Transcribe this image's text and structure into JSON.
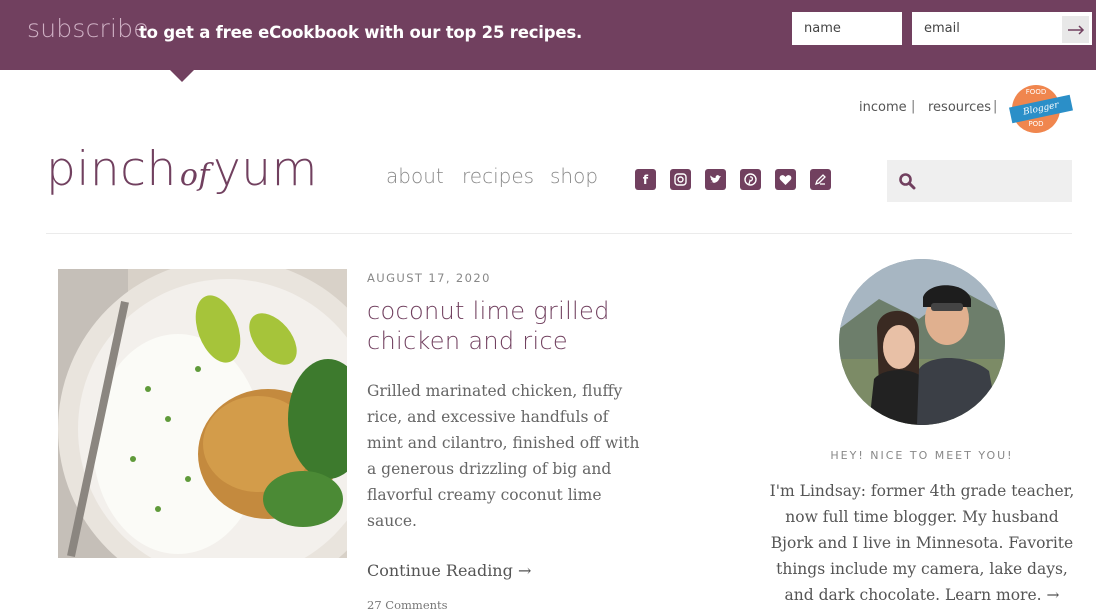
{
  "subscribe_bar": {
    "headline": "subscribe",
    "tagline": "to get a free eCookbook with our top 25 recipes.",
    "name_placeholder": "name",
    "email_placeholder": "email",
    "submit_icon": "arrow-right-icon"
  },
  "utility_nav": {
    "items": [
      "income",
      "resources"
    ],
    "separator": "|",
    "badge": {
      "top": "FOOD",
      "ribbon": "Blogger",
      "bottom": "POD"
    }
  },
  "logo": {
    "part1": "pinch",
    "part2": "of",
    "part3": "yum"
  },
  "main_nav": {
    "items": [
      "about",
      "recipes",
      "shop"
    ]
  },
  "social": {
    "icons": [
      "facebook-icon",
      "instagram-icon",
      "twitter-icon",
      "pinterest-icon",
      "bloglovin-icon",
      "blog-icon"
    ]
  },
  "search": {
    "placeholder": ""
  },
  "post": {
    "date": "AUGUST 17, 2020",
    "title": "coconut lime grilled chicken and rice",
    "excerpt": "Grilled marinated chicken, fluffy rice, and excessive handfuls of mint and cilantro, finished off with a generous drizzling of big and flavorful creamy coconut lime sauce.",
    "continue_label": "Continue Reading →",
    "comments": "27 Comments"
  },
  "sidebar": {
    "heading": "HEY! NICE TO MEET YOU!",
    "bio": "I'm Lindsay: former 4th grade teacher, now full time blogger. My husband Bjork and I live in Minnesota. Favorite things include my camera, lake days, and dark chocolate. Learn more. →"
  },
  "colors": {
    "brand": "#71405f",
    "text": "#555555",
    "muted": "#888888"
  }
}
